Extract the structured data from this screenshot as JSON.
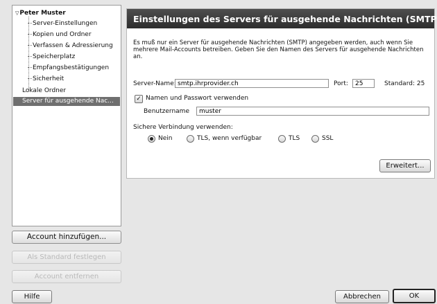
{
  "sidebar": {
    "account_name": "Peter Muster",
    "account_children": [
      "Server-Einstellungen",
      "Kopien und Ordner",
      "Verfassen & Adressierung",
      "Speicherplatz",
      "Empfangsbestätigungen",
      "Sicherheit"
    ],
    "local_folders": "Lokale Ordner",
    "outgoing_server": "Server für ausgehende Nac..."
  },
  "account_buttons": {
    "add": "Account hinzufügen...",
    "set_default": "Als Standard festlegen",
    "remove": "Account entfernen"
  },
  "panel": {
    "title": "Einstellungen des Servers für ausgehende Nachrichten (SMTP)",
    "description": "Es muß nur ein Server für ausgehende Nachrichten (SMTP) angegeben werden, auch wenn Sie mehrere Mail-Accounts betreiben. Geben Sie den Namen des Servers für ausgehende Nachrichten an.",
    "server_label": "Server-Name:",
    "server_value": "smtp.ihrprovider.ch",
    "port_label": "Port:",
    "port_value": "25",
    "default_label": "Standard:  25",
    "auth_checkbox_label": "Namen und Passwort verwenden",
    "auth_checked": true,
    "username_label": "Benutzername",
    "username_value": "muster",
    "secure_label": "Sichere Verbindung verwenden:",
    "secure_options": [
      "Nein",
      "TLS, wenn verfügbar",
      "TLS",
      "SSL"
    ],
    "secure_selected": "Nein",
    "advanced_button": "Erweitert..."
  },
  "footer": {
    "help": "Hilfe",
    "cancel": "Abbrechen",
    "ok": "OK"
  }
}
